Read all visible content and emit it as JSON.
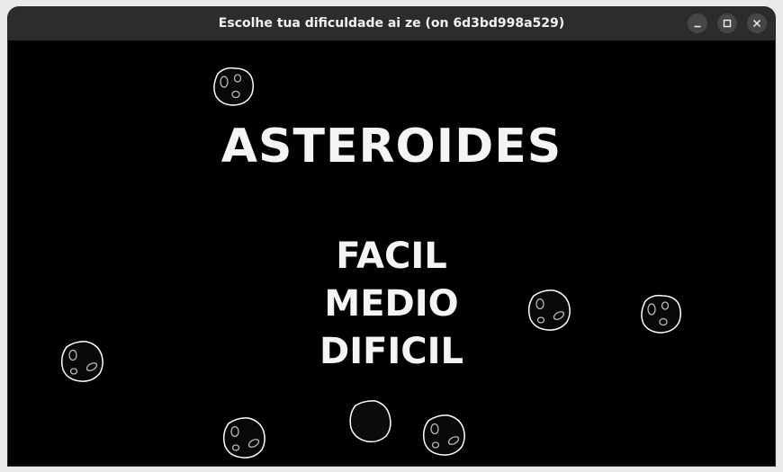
{
  "window": {
    "title": "Escolhe tua dificuldade ai ze (on 6d3bd998a529)"
  },
  "controls": {
    "minimize_icon": "minimize-icon",
    "maximize_icon": "maximize-icon",
    "close_icon": "close-icon"
  },
  "game": {
    "title": "ASTEROIDES",
    "menu": [
      {
        "label": "FACIL"
      },
      {
        "label": "MEDIO"
      },
      {
        "label": "DIFICIL"
      }
    ]
  },
  "colors": {
    "background": "#000000",
    "titlebar": "#2c2c2c",
    "text": "#f4f4f4",
    "asteroid_outline": "#ffffff"
  }
}
